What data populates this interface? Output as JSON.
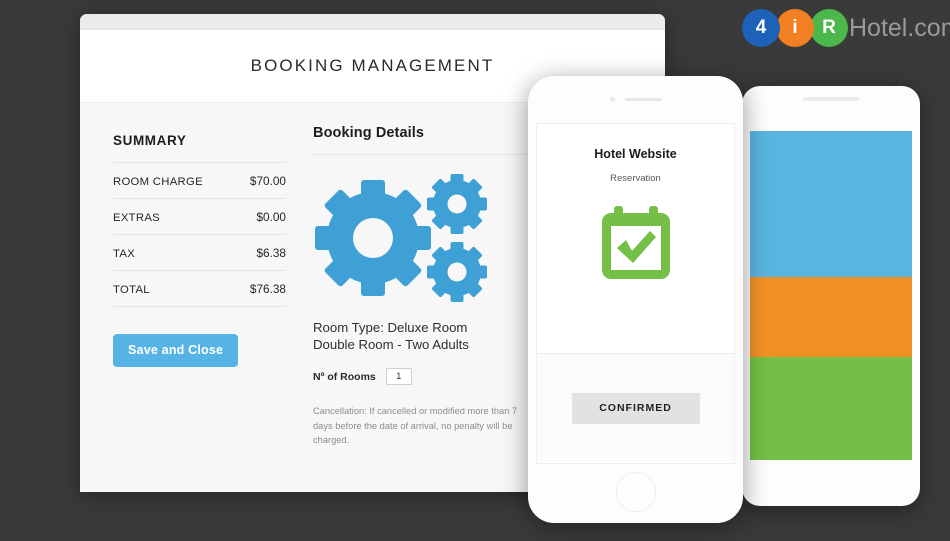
{
  "brand": {
    "logo_letters": [
      "4",
      "i",
      "R"
    ],
    "logo_text": "Hotel.com",
    "color_blue": "#1c62b9",
    "color_orange": "#f28022",
    "color_green": "#4cb84c",
    "text_color": "#9a9a9a"
  },
  "browser": {
    "page_title": "BOOKING MANAGEMENT"
  },
  "summary": {
    "heading": "SUMMARY",
    "rows": [
      {
        "label": "ROOM CHARGE",
        "value": "$70.00"
      },
      {
        "label": "EXTRAS",
        "value": "$0.00"
      },
      {
        "label": "TAX",
        "value": "$6.38"
      },
      {
        "label": "TOTAL",
        "value": "$76.38"
      }
    ],
    "save_button": "Save and Close",
    "save_button_color": "#56b3e6"
  },
  "details": {
    "heading": "Booking Details",
    "illustration": "gears-icon",
    "room_type_line1": "Room Type: Deluxe Room",
    "room_type_line2": "Double Room - Two Adults",
    "rooms_label": "Nº of Rooms",
    "rooms_value": "1",
    "cancellation": "Cancellation: If cancelled or modified more than 7 days before the date of arrival, no penalty will be charged."
  },
  "phone": {
    "title": "Hotel Website",
    "subtitle": "Reservation",
    "status_icon": "calendar-check-icon",
    "status_icon_color": "#74bf45",
    "confirm_button": "CONFIRMED"
  },
  "tablet": {
    "bands": [
      {
        "name": "blue-band",
        "color": "#59b4e0"
      },
      {
        "name": "orange-band",
        "color": "#f39024"
      },
      {
        "name": "green-band",
        "color": "#74bf45"
      }
    ]
  }
}
